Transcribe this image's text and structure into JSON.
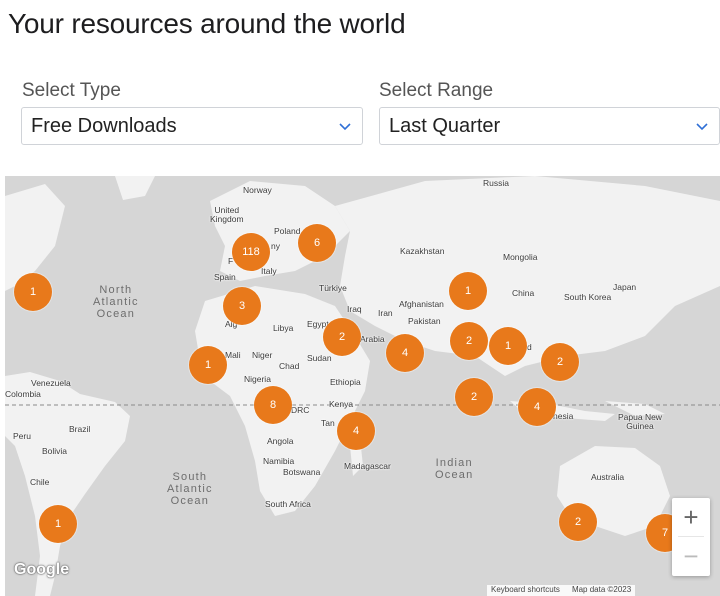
{
  "page_title": "Your resources around the world",
  "filters": {
    "type_label": "Select Type",
    "type_value": "Free Downloads",
    "range_label": "Select Range",
    "range_value": "Last Quarter"
  },
  "map": {
    "labels": {
      "norway": "Norway",
      "uk": "United\nKingdom",
      "poland": "Poland",
      "germany": "ny",
      "france": "F",
      "spain": "Spain",
      "italy": "Italy",
      "russia": "Russia",
      "kazakhstan": "Kazakhstan",
      "mongolia": "Mongolia",
      "china": "China",
      "south_korea": "South Korea",
      "japan": "Japan",
      "turkiye": "Türkiye",
      "iraq": "Iraq",
      "iran": "Iran",
      "afghanistan": "Afghanistan",
      "pakistan": "Pakistan",
      "arabia": "Arabia",
      "egypt": "Egypt",
      "libya": "Libya",
      "algeria": "Alg",
      "mali": "Mali",
      "niger": "Niger",
      "chad": "Chad",
      "sudan": "Sudan",
      "nigeria": "Nigeria",
      "ethiopia": "Ethiopia",
      "kenya": "Kenya",
      "drc": "DRC",
      "tanzania": "Tan",
      "angola": "Angola",
      "namibia": "Namibia",
      "botswana": "Botswana",
      "madagascar": "Madagascar",
      "south_africa": "South Africa",
      "venezuela": "Venezuela",
      "colombia": "Colombia",
      "peru": "Peru",
      "brazil": "Brazil",
      "bolivia": "Bolivia",
      "chile": "Chile",
      "indonesia": "nesia",
      "papua": "Papua New\nGuinea",
      "australia": "Australia",
      "india_d": "d"
    },
    "oceans": {
      "north_atlantic": "North\nAtlantic\nOcean",
      "south_atlantic": "South\nAtlantic\nOcean",
      "indian": "Indian\nOcean"
    },
    "clusters": [
      {
        "id": "north-america",
        "count": "1"
      },
      {
        "id": "western-europe",
        "count": "118"
      },
      {
        "id": "eastern-europe",
        "count": "6"
      },
      {
        "id": "north-africa",
        "count": "3"
      },
      {
        "id": "west-africa",
        "count": "1"
      },
      {
        "id": "middle-east",
        "count": "2"
      },
      {
        "id": "arabian-sea",
        "count": "4"
      },
      {
        "id": "central-asia",
        "count": "1"
      },
      {
        "id": "india",
        "count": "2"
      },
      {
        "id": "southeast-asia",
        "count": "1"
      },
      {
        "id": "philippines",
        "count": "2"
      },
      {
        "id": "indian-ocean",
        "count": "2"
      },
      {
        "id": "indonesia",
        "count": "4"
      },
      {
        "id": "central-africa",
        "count": "8"
      },
      {
        "id": "east-africa",
        "count": "4"
      },
      {
        "id": "south-america",
        "count": "1"
      },
      {
        "id": "australia-south",
        "count": "2"
      },
      {
        "id": "new-zealand",
        "count": "7"
      }
    ],
    "zoom_in": "+",
    "zoom_out": "−",
    "google_logo": "Google",
    "attribution": {
      "shortcuts": "Keyboard shortcuts",
      "map_data": "Map data ©2023"
    }
  },
  "colors": {
    "cluster": "#e8791b",
    "land": "#f4f4f4",
    "water": "#d7d7d7"
  }
}
